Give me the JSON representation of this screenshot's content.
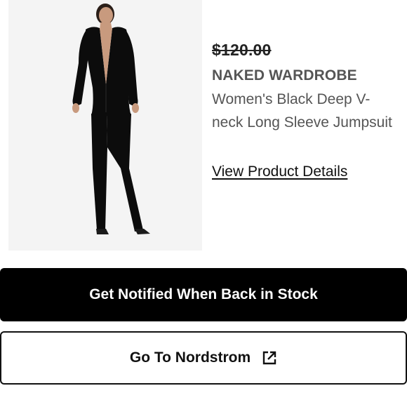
{
  "product": {
    "image_icon": "product-photo",
    "original_price": "$120.00",
    "brand": "NAKED WARDROBE",
    "title": "Women's Black Deep V-neck Long Sleeve Jumpsuit",
    "details_link": "View Product Details"
  },
  "actions": {
    "notify_label": "Get Notified When Back in Stock",
    "nordstrom_label": "Go To Nordstrom",
    "nordstrom_icon": "external-link-icon"
  },
  "colors": {
    "primary_button": "#000000",
    "primary_text": "#ffffff",
    "brand_text": "#555555"
  }
}
